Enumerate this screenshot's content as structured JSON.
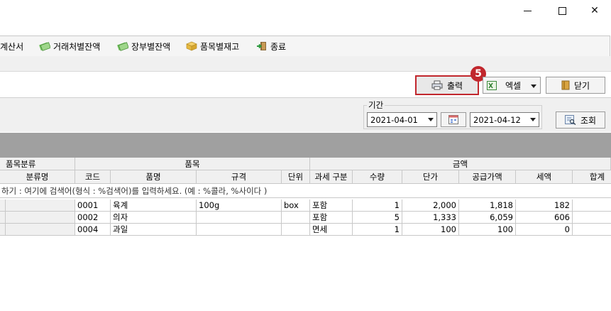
{
  "window": {
    "minimize": "—",
    "maximize": "☐",
    "close": "✕"
  },
  "menu": [
    {
      "label": "계산서",
      "icon": "invoice-icon"
    },
    {
      "label": "거래처별잔액",
      "icon": "money-icon"
    },
    {
      "label": "장부별잔액",
      "icon": "money-icon"
    },
    {
      "label": "품목별재고",
      "icon": "box-icon"
    },
    {
      "label": "종료",
      "icon": "exit-icon"
    }
  ],
  "toolbar": {
    "print": "출력",
    "excel": "엑셀",
    "close": "닫기",
    "badge": "5"
  },
  "period": {
    "label": "기간",
    "start": "2021-04-01",
    "end": "2021-04-12",
    "search": "조회"
  },
  "grid": {
    "group_headers": {
      "category": "품목분류",
      "item": "품목",
      "amount": "금액"
    },
    "columns": {
      "category_name": "분류명",
      "code": "코드",
      "name": "품명",
      "spec": "규격",
      "unit": "단위",
      "tax": "과세 구분",
      "qty": "수량",
      "price": "단가",
      "supply": "공급가액",
      "vat": "세액",
      "total": "합계"
    },
    "filter_hint": "하기 : 여기에 검색어(형식 : %검색어)를 입력하세요. (예 : %콜라, %사이다 )",
    "rows": [
      {
        "category": "",
        "code": "0001",
        "name": "육계",
        "spec": "100g",
        "unit": "box",
        "tax": "포함",
        "qty": "1",
        "price": "2,000",
        "supply": "1,818",
        "vat": "182"
      },
      {
        "category": "",
        "code": "0002",
        "name": "의자",
        "spec": "",
        "unit": "",
        "tax": "포함",
        "qty": "5",
        "price": "1,333",
        "supply": "6,059",
        "vat": "606"
      },
      {
        "category": "",
        "code": "0004",
        "name": "과일",
        "spec": "",
        "unit": "",
        "tax": "면세",
        "qty": "1",
        "price": "100",
        "supply": "100",
        "vat": "0"
      }
    ]
  }
}
